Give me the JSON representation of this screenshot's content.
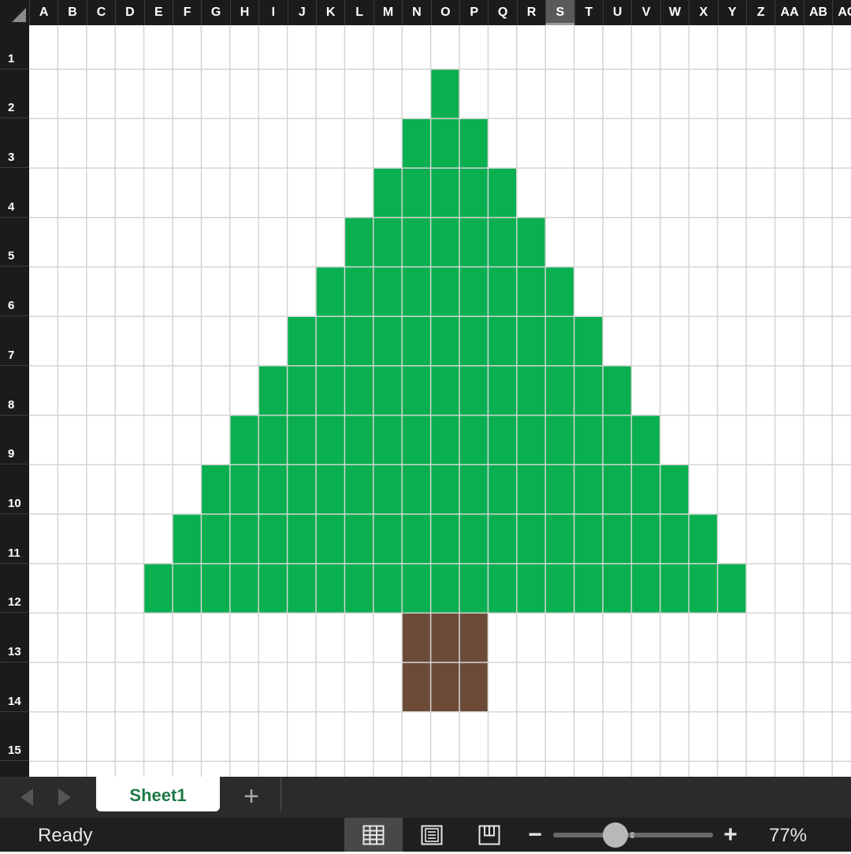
{
  "columns": {
    "labels": [
      "A",
      "B",
      "C",
      "D",
      "E",
      "F",
      "G",
      "H",
      "I",
      "J",
      "K",
      "L",
      "M",
      "N",
      "O",
      "P",
      "Q",
      "R",
      "S",
      "T",
      "U",
      "V",
      "W",
      "X",
      "Y",
      "Z",
      "AA",
      "AB",
      "AC"
    ],
    "selected": "S"
  },
  "rows": {
    "labels": [
      "1",
      "2",
      "3",
      "4",
      "5",
      "6",
      "7",
      "8",
      "9",
      "10",
      "11",
      "12",
      "13",
      "14",
      "15"
    ]
  },
  "cell_fills": [
    {
      "range": "O2",
      "color": "#0aaf4f"
    },
    {
      "range": "N3:P3",
      "color": "#0aaf4f"
    },
    {
      "range": "M4:Q4",
      "color": "#0aaf4f"
    },
    {
      "range": "L5:R5",
      "color": "#0aaf4f"
    },
    {
      "range": "K6:S6",
      "color": "#0aaf4f"
    },
    {
      "range": "J7:T7",
      "color": "#0aaf4f"
    },
    {
      "range": "I8:U8",
      "color": "#0aaf4f"
    },
    {
      "range": "H9:V9",
      "color": "#0aaf4f"
    },
    {
      "range": "G10:W10",
      "color": "#0aaf4f"
    },
    {
      "range": "F11:X11",
      "color": "#0aaf4f"
    },
    {
      "range": "E12:Y12",
      "color": "#0aaf4f"
    },
    {
      "range": "N13:P14",
      "color": "#6b4a37"
    }
  ],
  "colors": {
    "header_bg": "#1b1b1b",
    "gridline": "#d4d4d4",
    "tree_green": "#0aaf4f",
    "trunk_brown": "#6b4a37",
    "sheet_tab_text": "#1f7a45"
  },
  "tabs": {
    "active_sheet": "Sheet1",
    "add_sheet_label": "+"
  },
  "icons": {
    "prev_sheet": "chevron-left-icon",
    "next_sheet": "chevron-right-icon",
    "normal_view": "grid-icon",
    "page_layout": "page-layout-icon",
    "page_break": "page-break-icon"
  },
  "status": {
    "text": "Ready",
    "zoom_out_label": "−",
    "zoom_in_label": "+",
    "zoom_level": "77%",
    "zoom_fraction": 0.39
  }
}
